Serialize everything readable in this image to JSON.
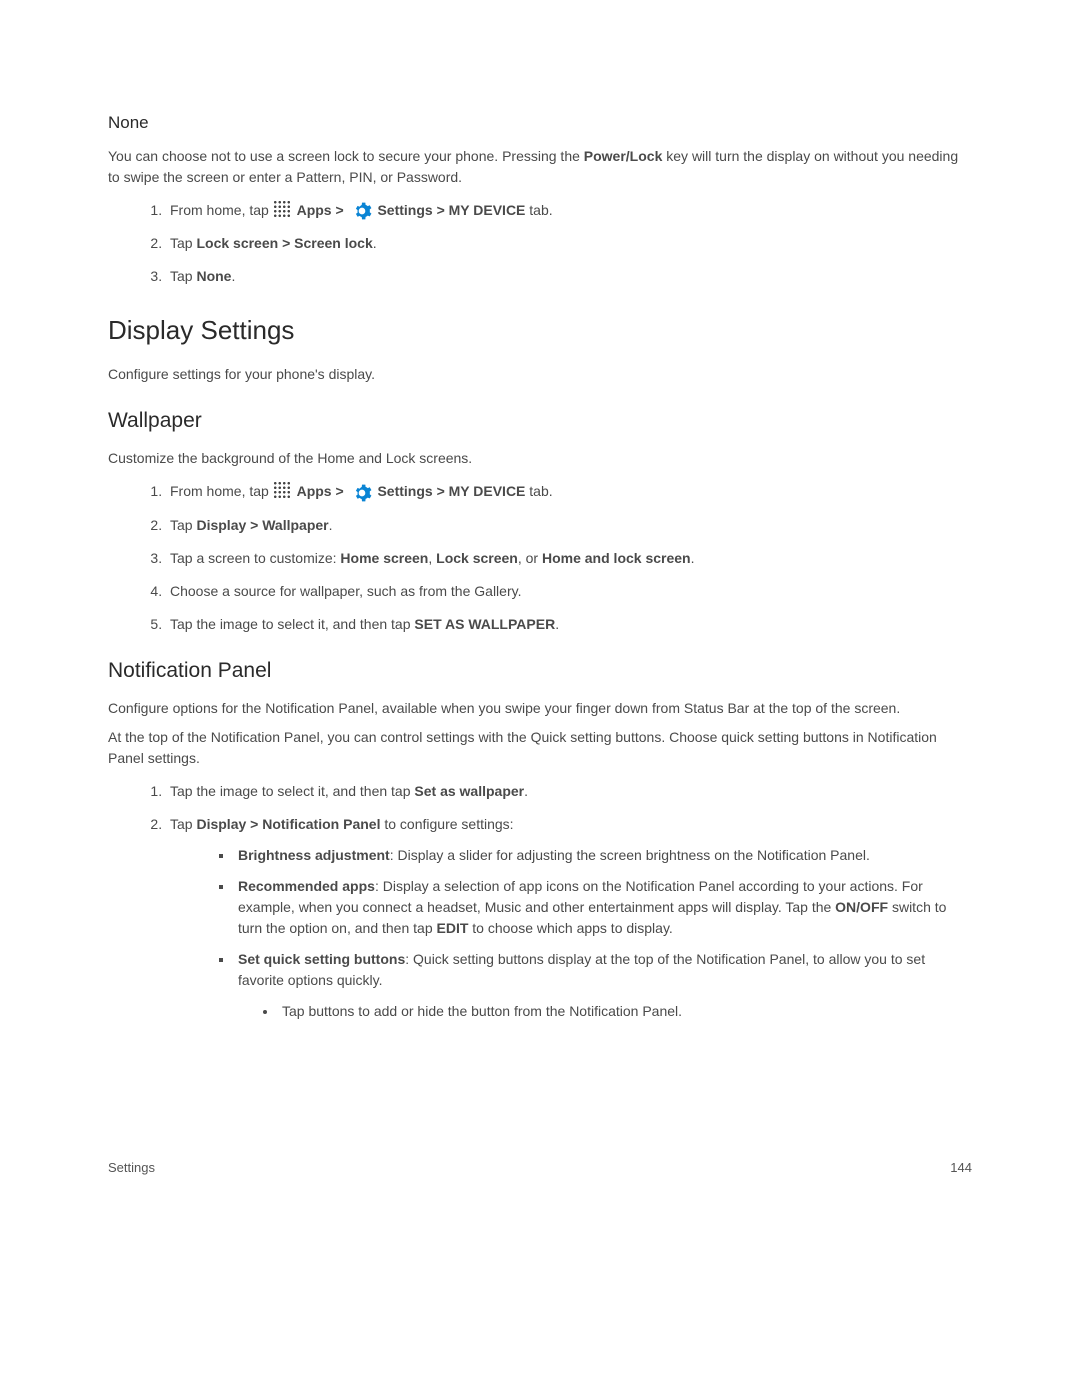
{
  "sec1": {
    "title": "None",
    "intro_pre": "You can choose not to use a screen lock to secure your phone. Pressing the ",
    "intro_bold": "Power/Lock",
    "intro_post": " key will turn the display on without you needing to swipe the screen or enter a Pattern, PIN, or Password.",
    "steps": {
      "s1_pre": "From home, tap ",
      "s1_apps": "Apps > ",
      "s1_settings": "Settings > MY DEVICE",
      "s1_post": " tab.",
      "s2_pre": "Tap ",
      "s2_bold": "Lock screen > Screen lock",
      "s2_post": ".",
      "s3_pre": "Tap ",
      "s3_bold": "None",
      "s3_post": "."
    }
  },
  "sec2": {
    "title": "Display Settings",
    "intro": "Configure settings for your phone's display."
  },
  "sec3": {
    "title": "Wallpaper",
    "intro": "Customize the background of the Home and Lock screens.",
    "steps": {
      "s1_pre": "From home, tap ",
      "s1_apps": "Apps > ",
      "s1_settings": "Settings > MY DEVICE",
      "s1_post": " tab.",
      "s2_pre": "Tap ",
      "s2_bold": "Display > Wallpaper",
      "s2_post": ".",
      "s3_pre": "Tap a screen to customize: ",
      "s3_b1": "Home screen",
      "s3_m1": ", ",
      "s3_b2": "Lock screen",
      "s3_m2": ", or ",
      "s3_b3": "Home and lock screen",
      "s3_post": ".",
      "s4": "Choose a source for wallpaper, such as from the Gallery.",
      "s5_pre": "Tap the image to select it, and then tap ",
      "s5_bold": "SET AS WALLPAPER",
      "s5_post": "."
    }
  },
  "sec4": {
    "title": "Notification Panel",
    "p1": "Configure options for the Notification Panel, available when you swipe your finger down from Status Bar at the top of the screen.",
    "p2": "At the top of the Notification Panel, you can control settings with the Quick setting buttons. Choose quick setting buttons in Notification Panel settings.",
    "steps": {
      "s1_pre": "Tap the image to select it, and then tap ",
      "s1_bold": "Set as wallpaper",
      "s1_post": ".",
      "s2_pre": "Tap ",
      "s2_bold": "Display > Notification Panel",
      "s2_post": " to configure settings:"
    },
    "bullets": {
      "b1_bold": "Brightness adjustment",
      "b1_text": ": Display a slider for adjusting the screen brightness on the Notification Panel.",
      "b2_bold": "Recommended apps",
      "b2_t1": ": Display a selection of app icons on the Notification Panel according to your actions. For example, when you connect a headset, Music and other entertainment apps will display. Tap the ",
      "b2_onoff": "ON/OFF",
      "b2_t2": " switch to turn the option on, and then tap ",
      "b2_edit": "EDIT",
      "b2_t3": " to choose which apps to display.",
      "b3_bold": "Set quick setting buttons",
      "b3_text": ": Quick setting buttons display at the top of the Notification Panel, to allow you to set favorite options quickly.",
      "b3_sub": "Tap buttons to add or hide the button from the Notification Panel."
    }
  },
  "footer": {
    "left": "Settings",
    "right": "144"
  }
}
